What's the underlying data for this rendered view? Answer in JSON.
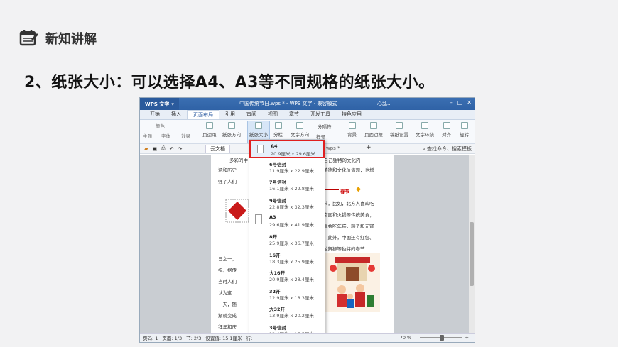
{
  "slide": {
    "section_title": "新知讲解",
    "heading": "2、纸张大小：可以选择A4、A3等不同规格的纸张大小。"
  },
  "titlebar": {
    "app_name": "WPS 文字",
    "doc_title": "中国传统节日.wps * - WPS 文字 - 兼容模式",
    "user": "心乱..."
  },
  "tabs": [
    "开始",
    "插入",
    "页面布局",
    "引用",
    "审阅",
    "视图",
    "章节",
    "开发工具",
    "特色应用"
  ],
  "ribbon": {
    "row_small": [
      "颜色",
      "主题",
      "字体",
      "效果"
    ],
    "buttons": [
      "页边距",
      "纸张方向",
      "纸张大小",
      "分栏",
      "文字方向",
      "行号",
      "分隔符",
      "背景",
      "页面边框",
      "稿纸设置",
      "文字环绕",
      "对齐",
      "旋转"
    ]
  },
  "docbar": {
    "tab1": "云文档",
    "tab2": "wps *",
    "search": "查找命令、搜索模板"
  },
  "page_text": {
    "l1a": "多彩的中",
    "l1b": "有自己独特的文化内",
    "l2a": "涵和历史",
    "l2b": "美德和文化价值观，也增",
    "l3a": "强了人们",
    "chun": "春节",
    "r1": "节，比如，北方人喜欢吃",
    "r2": "南面和火锅等传统美食；",
    "r3": "说会吃年糕，粽子和元宵",
    "r4": "。此外，中国还有红包、",
    "r5": "龙舞狮等独特的春节",
    "b1": "日之一，",
    "b2": "祝，据传",
    "b3": "当时人们",
    "b4": "认为这",
    "b5": "一天，随",
    "b6": "渐就变成",
    "b7": "拜年和庆",
    "b8": "中国各地"
  },
  "paper_sizes": [
    {
      "name": "A4",
      "size": "20.9厘米 x 29.6厘米",
      "selected": true
    },
    {
      "name": "6号信封",
      "size": "11.9厘米 x 22.9厘米"
    },
    {
      "name": "7号信封",
      "size": "16.1厘米 x 22.8厘米"
    },
    {
      "name": "9号信封",
      "size": "22.8厘米 x 32.3厘米"
    },
    {
      "name": "A3",
      "size": "29.6厘米 x 41.9厘米"
    },
    {
      "name": "8开",
      "size": "25.9厘米 x 36.7厘米"
    },
    {
      "name": "16开",
      "size": "18.3厘米 x 25.9厘米"
    },
    {
      "name": "大16开",
      "size": "20.9厘米 x 28.4厘米"
    },
    {
      "name": "32开",
      "size": "12.9厘米 x 18.3厘米"
    },
    {
      "name": "大32开",
      "size": "13.9厘米 x 20.2厘米"
    },
    {
      "name": "3号信封",
      "size": "12.4厘米 x 17.5厘米"
    }
  ],
  "statusbar": {
    "page_num": "页码: 1",
    "pages": "页面: 1/3",
    "section": "节: 2/3",
    "setting": "设置值: 15.1厘米",
    "row": "行:",
    "zoom": "70 %"
  },
  "colors": {
    "accent_red": "#e02020",
    "title_blue": "#2f62a6",
    "ribbon_selected": "#d7e6f7"
  }
}
